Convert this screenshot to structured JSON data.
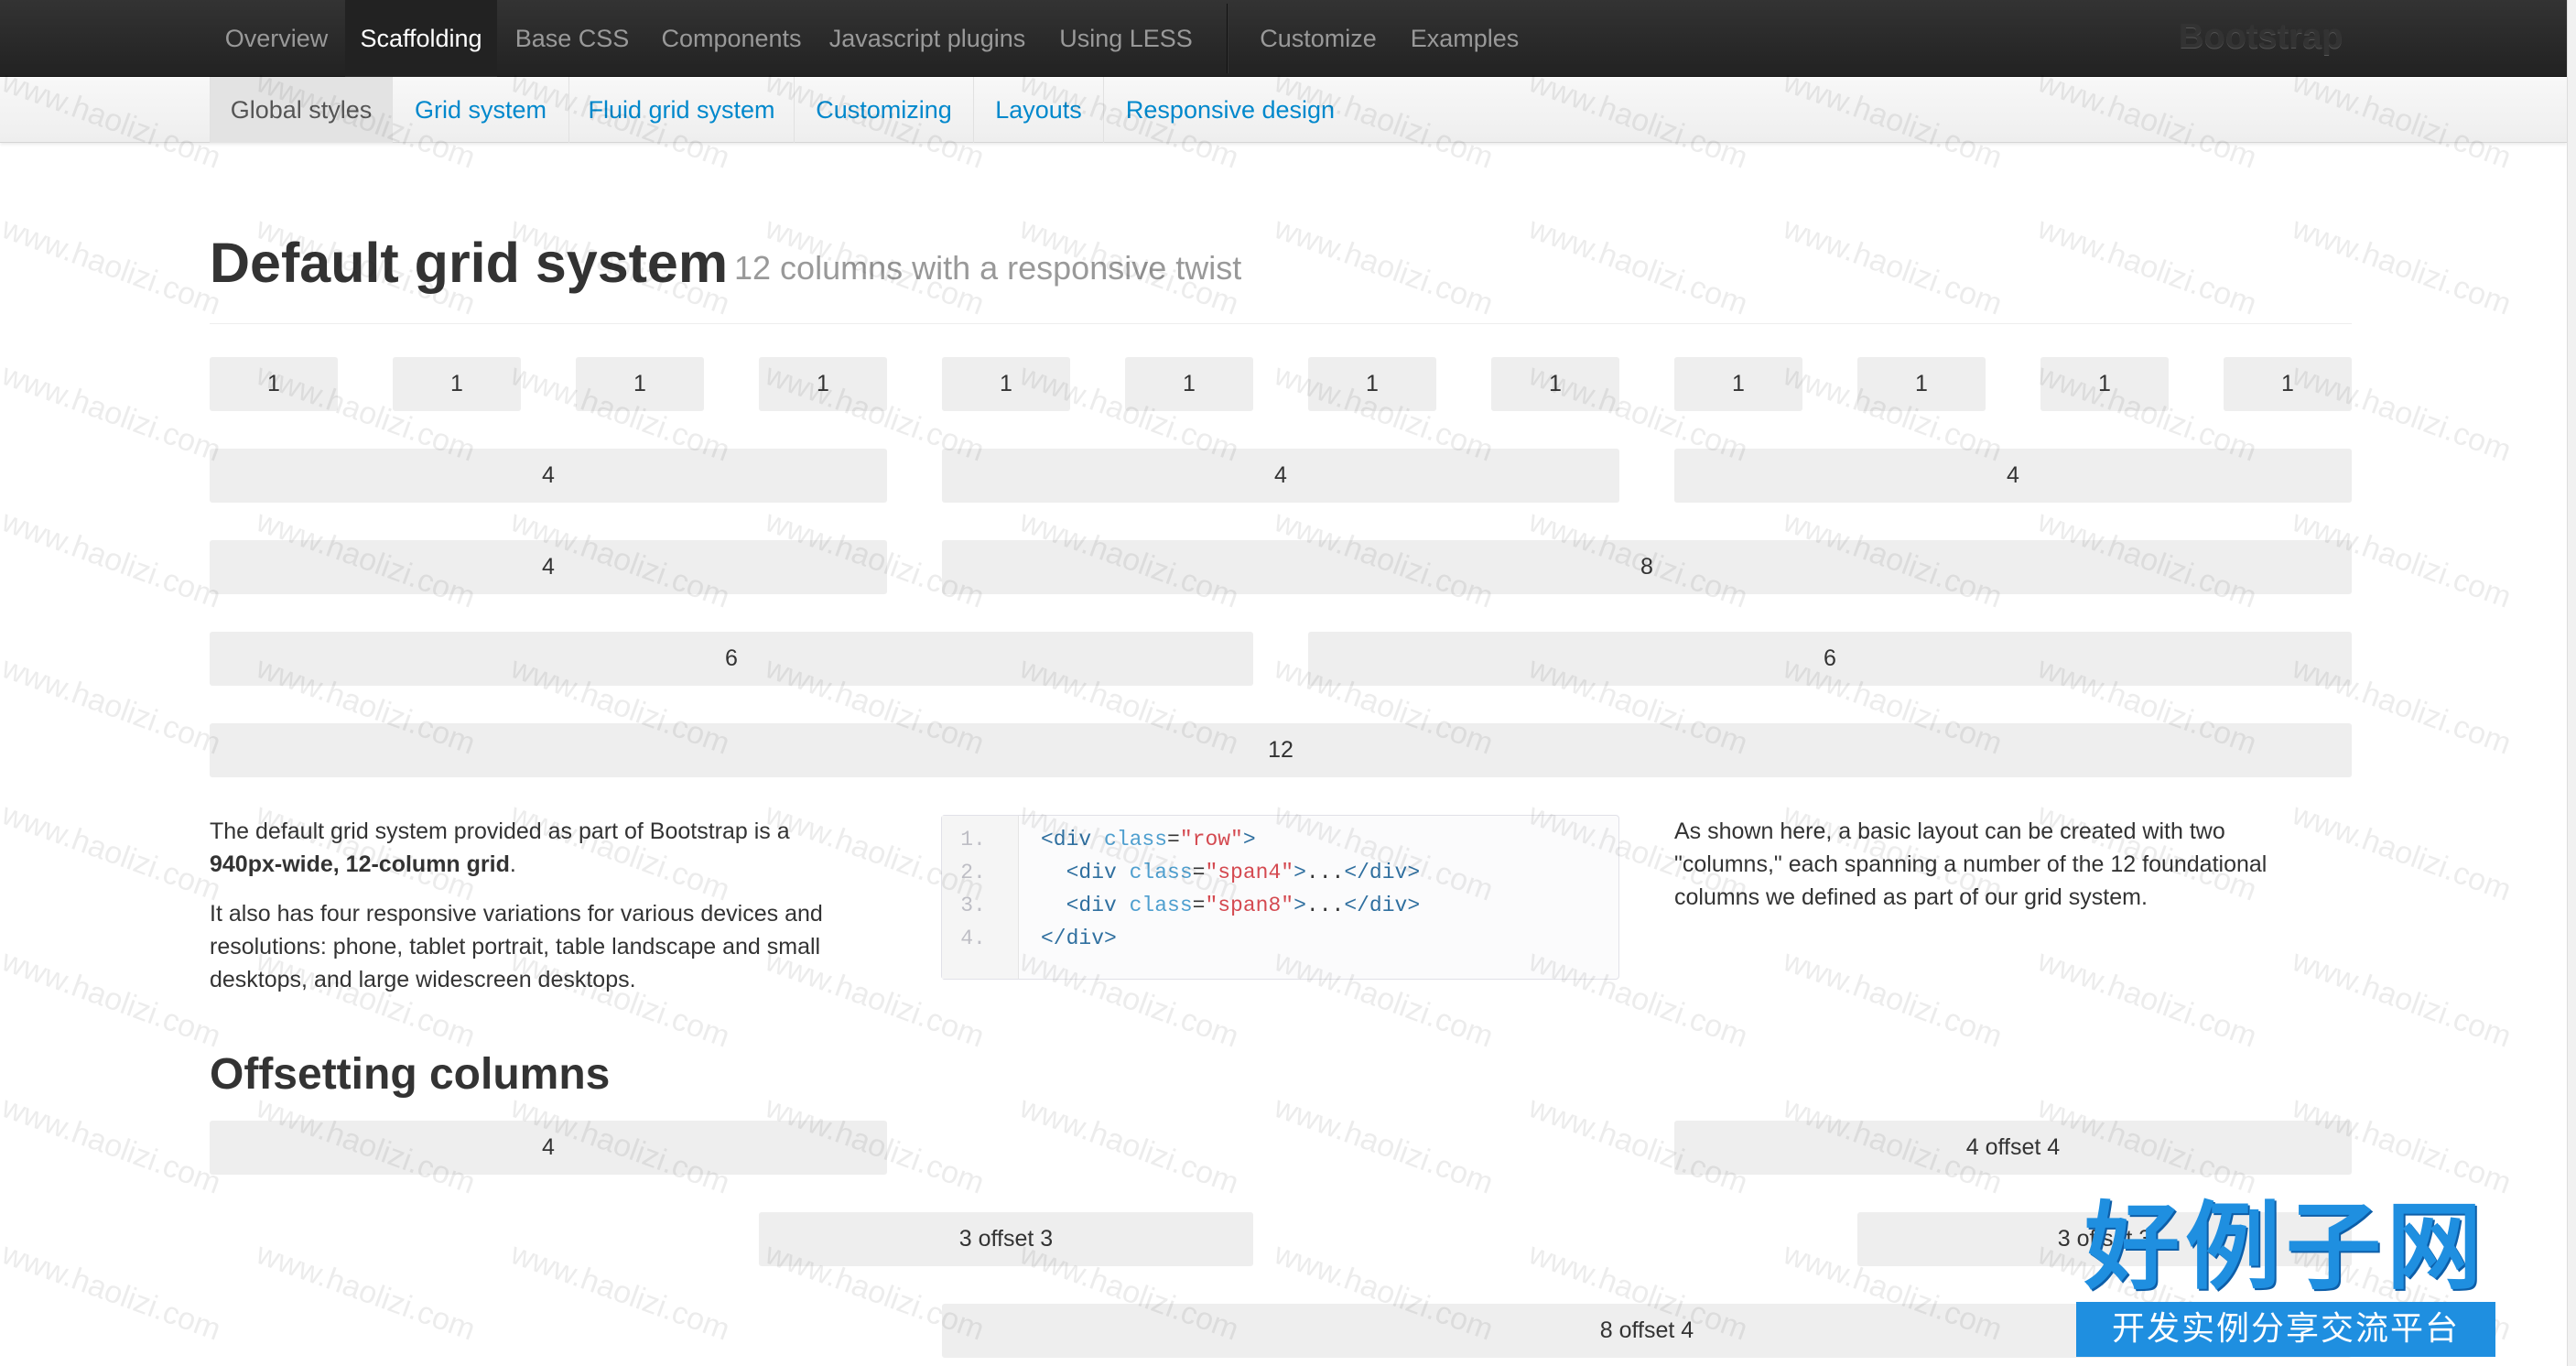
{
  "navbar": {
    "items": [
      "Overview",
      "Scaffolding",
      "Base CSS",
      "Components",
      "Javascript plugins",
      "Using LESS",
      "Customize",
      "Examples"
    ],
    "active": "Scaffolding",
    "brand": "Bootstrap"
  },
  "subnav": {
    "items": [
      "Global styles",
      "Grid system",
      "Fluid grid system",
      "Customizing",
      "Layouts",
      "Responsive design"
    ],
    "active": "Global styles"
  },
  "heading": {
    "title": "Default grid system",
    "subtitle": "12 columns with a responsive twist"
  },
  "grid": {
    "row1": [
      "1",
      "1",
      "1",
      "1",
      "1",
      "1",
      "1",
      "1",
      "1",
      "1",
      "1",
      "1"
    ],
    "row2": [
      "4",
      "4",
      "4"
    ],
    "row3": [
      "4",
      "8"
    ],
    "row4": [
      "6",
      "6"
    ],
    "row5": [
      "12"
    ]
  },
  "description": {
    "left_p1_a": "The default grid system provided as part of Bootstrap is a",
    "left_p1_b": "940px-wide, 12-column grid",
    "left_p1_c": ".",
    "left_p2_l1": "It also has four responsive variations for various devices and",
    "left_p2_l2": "resolutions: phone, tablet portrait, table landscape and small",
    "left_p2_l3": "desktops, and large widescreen desktops.",
    "right_l1": "As shown here, a basic layout can be created with two",
    "right_l2": "\"columns,\" each spanning a number of the 12 foundational",
    "right_l3": "columns we defined as part of our grid system."
  },
  "code": {
    "lines": [
      {
        "n": "1.",
        "indent": "",
        "tag": "div",
        "cls": "row",
        "rest": "",
        "close": false
      },
      {
        "n": "2.",
        "indent": "  ",
        "tag": "div",
        "cls": "span4",
        "rest": "...",
        "close": true
      },
      {
        "n": "3.",
        "indent": "  ",
        "tag": "div",
        "cls": "span8",
        "rest": "...",
        "close": true
      },
      {
        "n": "4.",
        "text": "</div>"
      }
    ]
  },
  "offsetting": {
    "title": "Offsetting columns",
    "cells": [
      "4",
      "4 offset 4",
      "3 offset 3",
      "3 offset 3",
      "8 offset 4"
    ]
  },
  "watermark": {
    "text": "www.haolizi.com",
    "logo_top": "好例子网",
    "logo_bottom": "开发实例分享交流平台"
  },
  "colors": {
    "navbar_bg": "#222222",
    "link": "#0088cc",
    "cell_bg": "#eeeeee",
    "logo_blue": "#1f8fe0"
  }
}
